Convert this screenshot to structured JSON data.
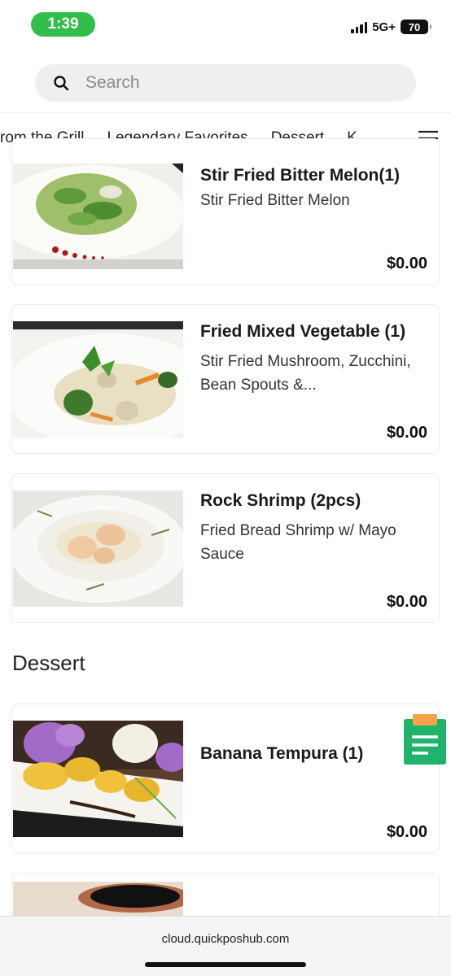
{
  "status": {
    "time": "1:39",
    "network": "5G+",
    "battery": "70"
  },
  "search": {
    "placeholder": "Search"
  },
  "tabs": [
    {
      "label": "rom the Grill"
    },
    {
      "label": "Legendary Favorites"
    },
    {
      "label": "Dessert"
    },
    {
      "label": "K"
    }
  ],
  "items": [
    {
      "name": "Stir Fried Bitter Melon(1)",
      "description": "Stir Fried Bitter Melon",
      "price": "$0.00"
    },
    {
      "name": "Fried Mixed Vegetable (1)",
      "description": "Stir Fried Mushroom, Zucchini, Bean Spouts &...",
      "price": "$0.00"
    },
    {
      "name": "Rock Shrimp (2pcs)",
      "description": "Fried Bread Shrimp w/ Mayo Sauce",
      "price": "$0.00"
    }
  ],
  "sections": [
    {
      "title": "Dessert"
    }
  ],
  "dessert_items": [
    {
      "name": "Banana Tempura  (1)",
      "price": "$0.00"
    }
  ],
  "browser": {
    "url": "cloud.quickposhub.com"
  },
  "colors": {
    "status_green": "#2fbf4a",
    "float_green": "#1fb36b",
    "float_orange": "#f5a24b"
  }
}
